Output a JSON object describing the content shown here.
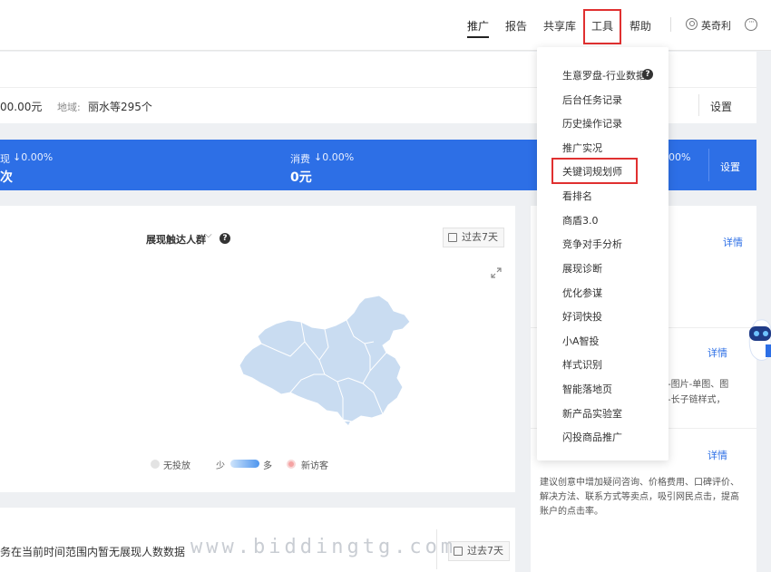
{
  "nav": {
    "items": [
      "推广",
      "报告",
      "共享库",
      "工具",
      "帮助"
    ],
    "user_name": "英奇利",
    "more": "···"
  },
  "info": {
    "budget_value": "00.00元",
    "region_label": "地域:",
    "region_value": "丽水等295个",
    "settings_label": "设置"
  },
  "stats": {
    "left_partial_label": "现",
    "left_change": "↓0.00%",
    "left_partial_value": "次",
    "spend_label": "消费",
    "spend_change": "↓0.00%",
    "spend_value": "0元",
    "right_change": "00%",
    "settings_label": "设置"
  },
  "map_card": {
    "audience_label": "展现触达人群",
    "period_label": "过去7天",
    "legend_none": "无投放",
    "legend_less": "少",
    "legend_more": "多",
    "legend_new": "新访客"
  },
  "right_cards": {
    "detail_1": "详情",
    "detail_2": "详情",
    "detail_3": "详情",
    "text_2a": "-图片-单图、图",
    "text_2b": "-长子链样式，",
    "text_3": "建议创意中增加疑问咨询、价格费用、口碑评价、解决方法、联系方式等卖点，吸引网民点击，提高账户的点击率。"
  },
  "bottom_card": {
    "message": "务在当前时间范围内暂无展现人数数据",
    "period_label": "过去7天"
  },
  "dropdown": {
    "items": [
      "生意罗盘-行业数据",
      "后台任务记录",
      "历史操作记录",
      "推广实况",
      "关键词规划师",
      "看排名",
      "商盾3.0",
      "竞争对手分析",
      "展现诊断",
      "优化参谋",
      "好词快投",
      "小A智投",
      "样式识别",
      "智能落地页",
      "新产品实验室",
      "闪投商品推广"
    ]
  },
  "watermark": "www.biddingtg.com",
  "colors": {
    "accent": "#2d6fe6",
    "highlight": "#e03030",
    "map_fill": "#c9dcf1"
  }
}
